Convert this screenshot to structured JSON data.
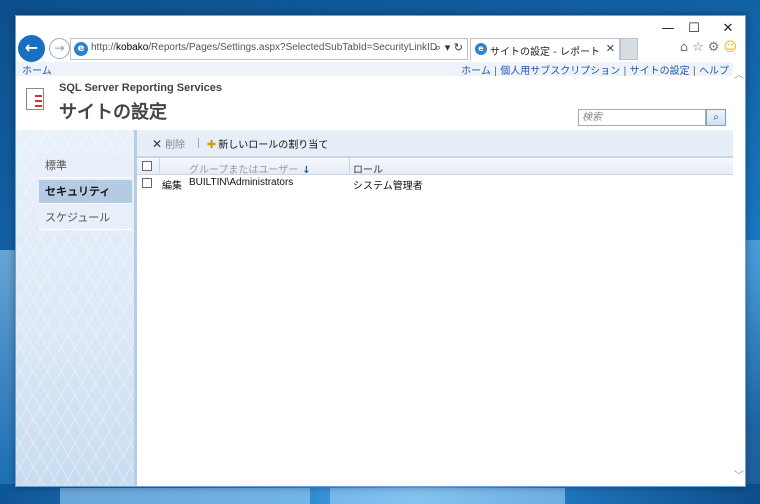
{
  "window": {
    "minimize": "—",
    "maximize": "☐",
    "close": "✕"
  },
  "nav": {
    "back": "←",
    "forward": "→",
    "address_prefix": "http://",
    "address_host": "kobako",
    "address_path": "/Reports/Pages/Settings.aspx?SelectedSubTabId=SecurityLinkID",
    "address_actions": "⌕ ▾ ↻"
  },
  "tab": {
    "label": "サイトの設定 - レポート マネー...",
    "close": "✕"
  },
  "tool_icons": [
    "⌂",
    "☆",
    "⚙",
    "☺"
  ],
  "topnav": {
    "home": "ホーム",
    "links": [
      "ホーム",
      "個人用サブスクリプション",
      "サイトの設定",
      "ヘルプ"
    ],
    "separator": "|"
  },
  "header": {
    "product_name": "SQL Server Reporting Services",
    "page_title": "サイトの設定"
  },
  "search": {
    "placeholder": "検索",
    "button": "⌕"
  },
  "sidebar": {
    "items": [
      {
        "label": "標準",
        "active": false
      },
      {
        "label": "セキュリティ",
        "active": true
      },
      {
        "label": "スケジュール",
        "active": false
      }
    ]
  },
  "toolbar": {
    "delete_label": "削除",
    "new_role_label": "新しいロールの割り当て"
  },
  "grid": {
    "columns": {
      "user": "グループまたはユーザー",
      "role": "ロール"
    },
    "sort_indicator": "↓",
    "rows": [
      {
        "action": "編集",
        "user": "BUILTIN\\Administrators",
        "role": "システム管理者"
      }
    ]
  }
}
